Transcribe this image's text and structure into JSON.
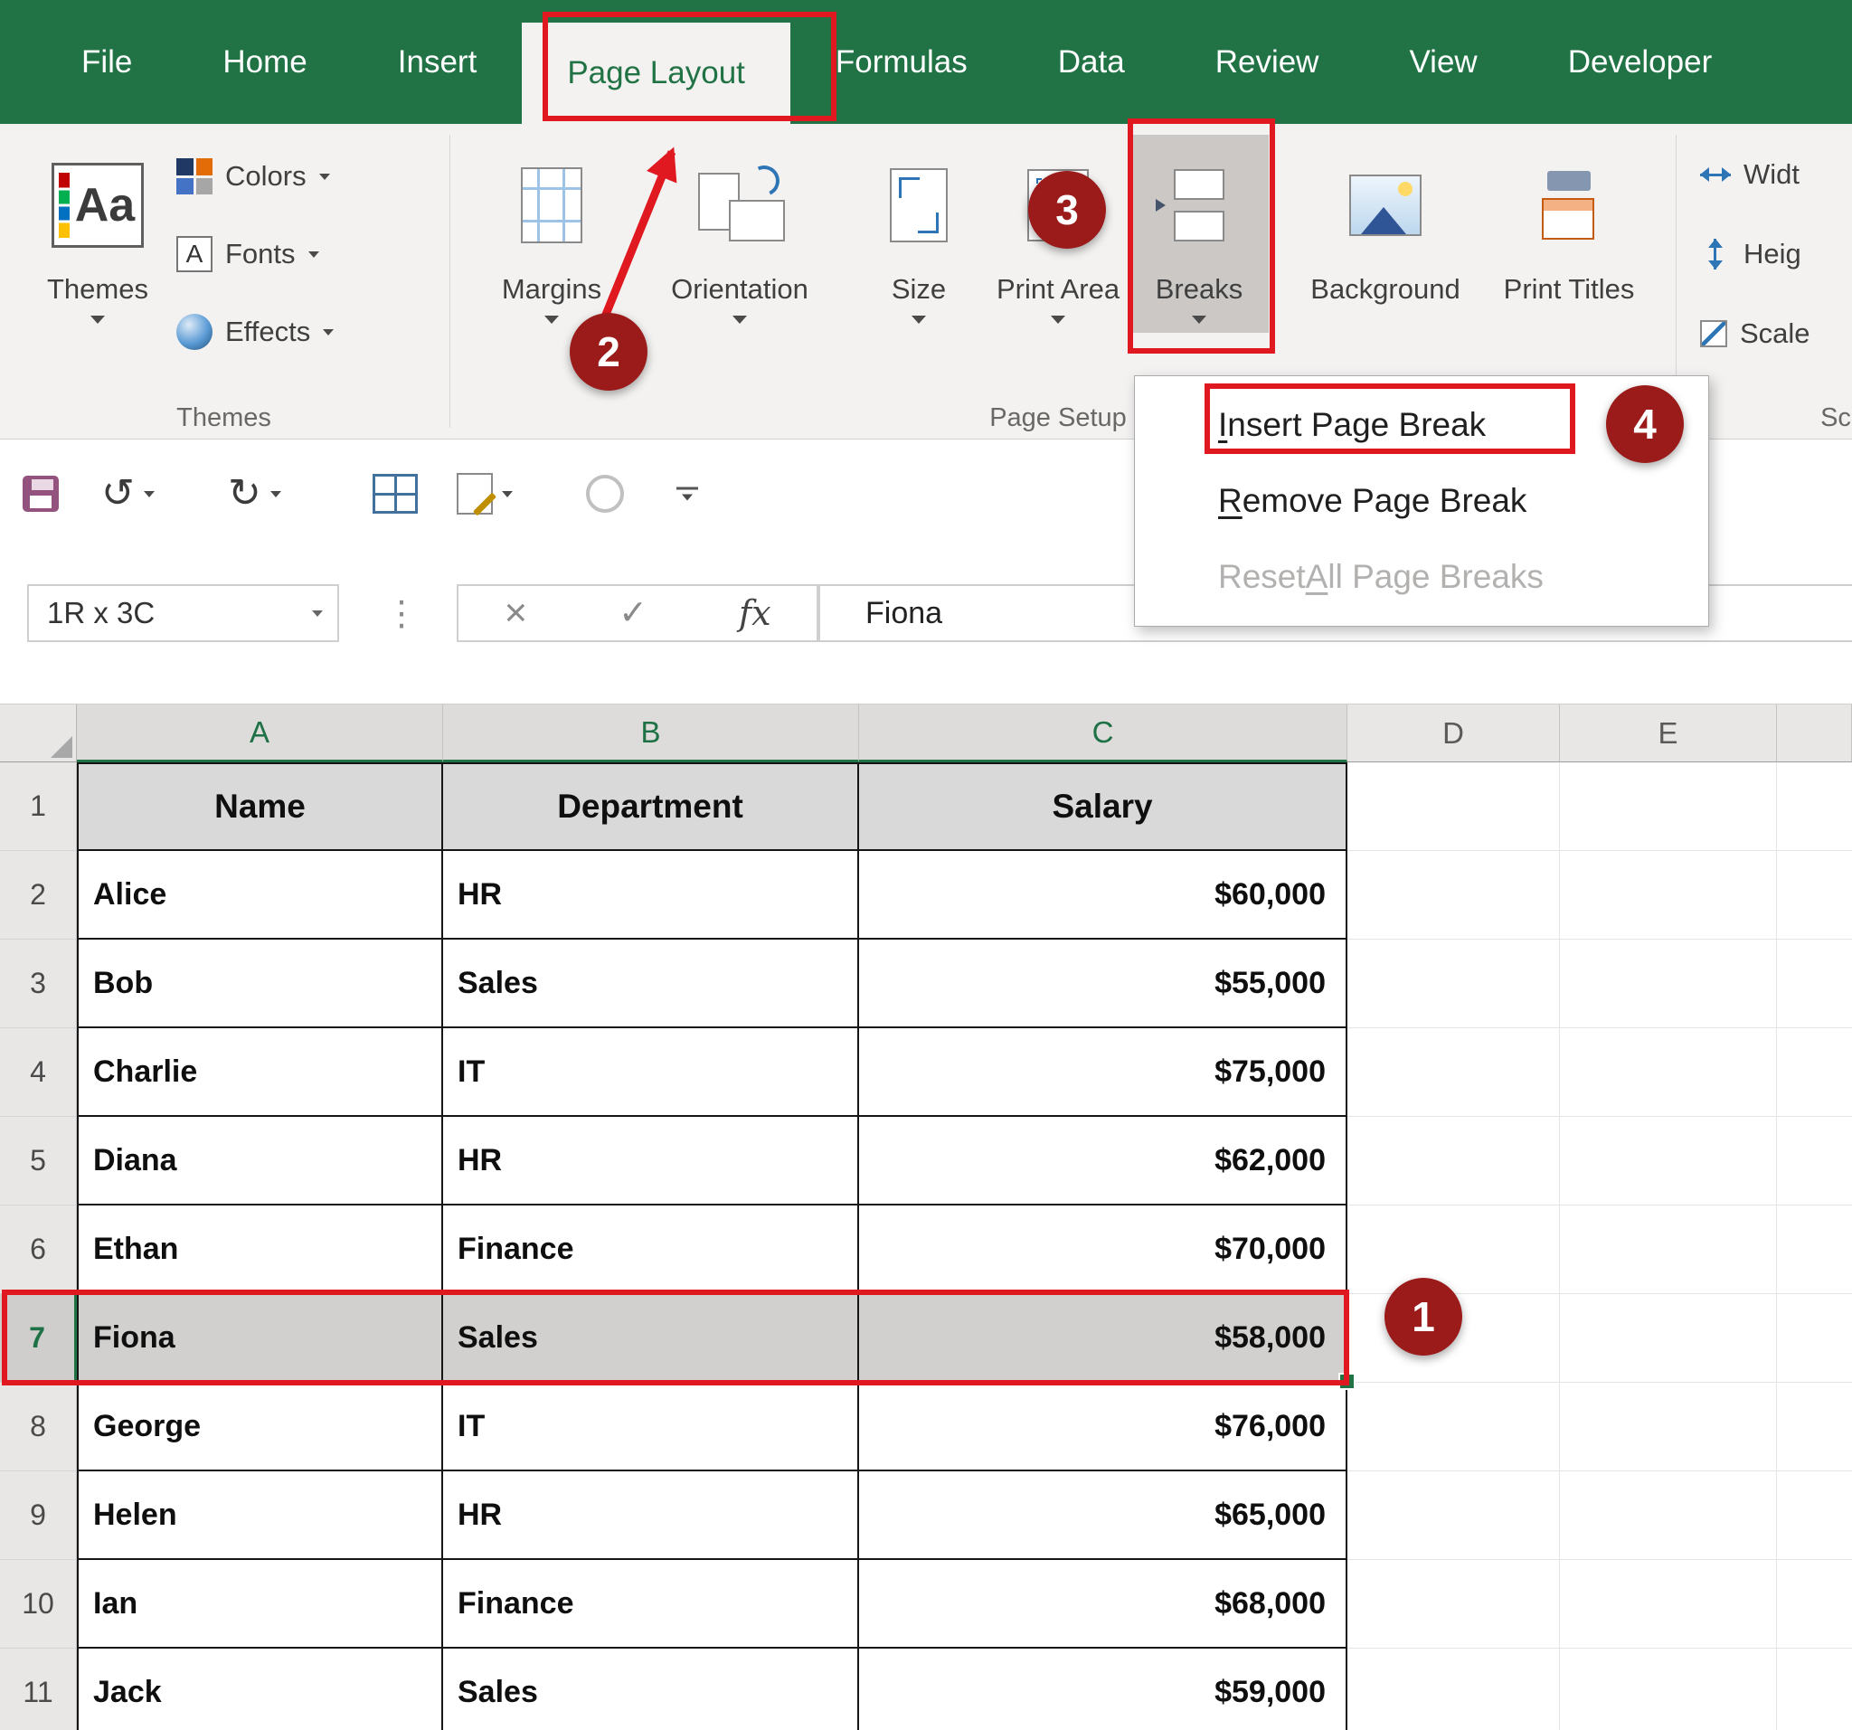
{
  "colors": {
    "excel_green": "#217346",
    "annotation_box_red": "#e0181f",
    "annotation_circle_red": "#9b1b1b",
    "selected_fill": "#d2d0ce",
    "table_header_fill": "#d9d9d9"
  },
  "ribbon": {
    "tabs": [
      "File",
      "Home",
      "Insert",
      "Page Layout",
      "Formulas",
      "Data",
      "Review",
      "View",
      "Developer"
    ],
    "active_tab": "Page Layout",
    "themes_group": {
      "label": "Themes",
      "big_button": "Themes",
      "items": [
        "Colors",
        "Fonts",
        "Effects"
      ]
    },
    "page_setup_group": {
      "label": "Page Setup",
      "buttons": [
        "Margins",
        "Orientation",
        "Size",
        "Print Area",
        "Breaks",
        "Background",
        "Print Titles"
      ]
    },
    "scale_group": {
      "label": "Sc",
      "items": [
        "Widt",
        "Heig",
        "Scale"
      ]
    }
  },
  "icons": {
    "themes_glyph": "Aa",
    "fonts_glyph": "A",
    "undo_glyph": "↺",
    "redo_glyph": "↻",
    "name_box_separator": "⋮",
    "cancel_glyph": "×",
    "enter_glyph": "✓",
    "fx_glyph": "fx"
  },
  "formula_bar": {
    "name_box": "1R x 3C",
    "value": "Fiona"
  },
  "breaks_menu": {
    "items": [
      {
        "pre": "",
        "key": "I",
        "post": "nsert Page Break",
        "enabled": true
      },
      {
        "pre": "",
        "key": "R",
        "post": "emove Page Break",
        "enabled": true
      },
      {
        "pre": "Reset ",
        "key": "A",
        "post": "ll Page Breaks",
        "enabled": false
      }
    ]
  },
  "annotations": {
    "step1": "1",
    "step2": "2",
    "step3": "3",
    "step4": "4"
  },
  "sheet": {
    "columns": [
      "A",
      "B",
      "C",
      "D",
      "E"
    ],
    "row_numbers": [
      "1",
      "2",
      "3",
      "4",
      "5",
      "6",
      "7",
      "8",
      "9",
      "10",
      "11"
    ],
    "table": {
      "headers": [
        "Name",
        "Department",
        "Salary"
      ],
      "rows": [
        [
          "Alice",
          "HR",
          "$60,000"
        ],
        [
          "Bob",
          "Sales",
          "$55,000"
        ],
        [
          "Charlie",
          "IT",
          "$75,000"
        ],
        [
          "Diana",
          "HR",
          "$62,000"
        ],
        [
          "Ethan",
          "Finance",
          "$70,000"
        ],
        [
          "Fiona",
          "Sales",
          "$58,000"
        ],
        [
          "George",
          "IT",
          "$76,000"
        ],
        [
          "Helen",
          "HR",
          "$65,000"
        ],
        [
          "Ian",
          "Finance",
          "$68,000"
        ],
        [
          "Jack",
          "Sales",
          "$59,000"
        ]
      ]
    }
  }
}
